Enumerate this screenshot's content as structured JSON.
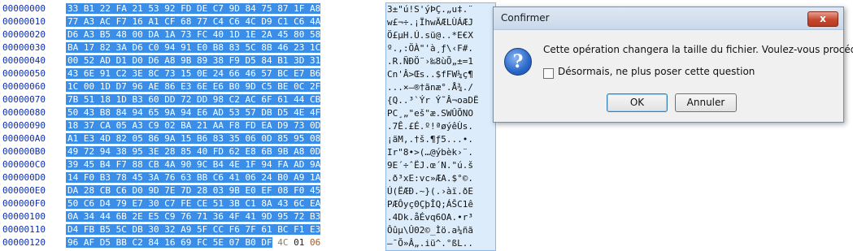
{
  "editor": {
    "offsets": [
      "00000000",
      "00000010",
      "00000020",
      "00000030",
      "00000040",
      "00000050",
      "00000060",
      "00000070",
      "00000080",
      "00000090",
      "000000A0",
      "000000B0",
      "000000C0",
      "000000D0",
      "000000E0",
      "000000F0",
      "00000100",
      "00000110",
      "00000120"
    ],
    "hex_rows": [
      "33 B1 22 FA 21 53 92 FD DE C7 9D 84 75 87 1F A8",
      "77 A3 AC F7 16 A1 CF 68 77 C4 C6 4C D9 C1 C6 4A",
      "D6 A3 B5 48 00 DA 1A 73 FC 40 1D 1E 2A 45 80 58",
      "BA 17 82 3A D6 C0 94 91 E0 B8 83 5C 8B 46 23 1C",
      "00 52 AD D1 D0 D6 A8 9B 89 38 F9 D5 84 B1 3D 31",
      "43 6E 91 C2 3E 8C 73 15 0E 24 66 46 57 BC E7 B6",
      "1C 00 1D D7 96 AE 86 E3 6E E6 B0 9D C5 BE 0C 2F",
      "7B 51 18 1D B3 60 DD 72 DD 98 C2 AC 6F 61 44 CB",
      "50 43 B8 84 94 65 9A 94 E6 AD 53 57 DB D5 4E 4F",
      "18 37 CA 05 A3 C9 02 BA 21 AA F8 FD EA D9 73 0D",
      "A1 E3 4D 82 05 86 9A 15 B6 83 35 06 0D 85 95 08",
      "49 72 94 38 95 3E 28 85 40 FD 62 E8 6B 9B A8 0D",
      "39 45 B4 F7 88 CB 4A 90 9C B4 4E 1F 94 FA AD 9A",
      "14 F0 B3 78 45 3A 76 63 BB C6 41 06 24 B0 A9 1A",
      "DA 28 CB C6 D0 9D 7E 7D 28 03 9B E0 EF 08 F0 45",
      "50 C6 D4 79 E7 30 C7 FE CE 51 3B C1 8A 43 6C EA",
      "0A 34 44 6B 2E E5 C9 76 71 36 4F 41 9D 95 72 B3",
      "D4 FB B5 5C DB 30 32 A9 5F CC F6 7F 61 BC F1 E3",
      "96 AF D5 BB C2 84 16 69 FC 5E 07 B0 DF"
    ],
    "last_row_tail": [
      "4C",
      "01",
      "06"
    ],
    "ascii_rows": [
      "3±\"ú!S'ýÞÇ.„u‡.¨",
      "w£¬÷.¡ÏhwÄÆLÙÁÆJ",
      "Ö£µH.Ú.sü@..*E€X",
      "º.‚:ÖÀ\"'à¸ƒ\\‹F#.",
      ".R.ÑÐÖ¨›‰8ùÕ„±=1",
      "Cn'Â>Œs..$fFW¼ç¶",
      "...×–®†ãnæ°.Å¾./",
      "{Q..³`Ýr Ý˜Â¬oaDË",
      "PC¸„\"eš\"æ.SWÛÕNO",
      ".7Ê.£É.º!ªøýêÙs.",
      "¡ãM‚.†š.¶ƒ5...•.",
      "Ir\"8•>(…@ýbèk›¨.",
      "9E´÷ˆËJ.œ´N.\"ú.š",
      ".ð³xE:vc»ÆA.$°©.",
      "Ú(ËÆÐ.~}(.›àï.ðE",
      "PÆÔyç0ÇþÎQ;ÁŠC1ê",
      ".4Dk.åÉvq6OA.•r³",
      "Ôûµ\\Û02©_Ìö.a¼ñã",
      "–¯Õ»Â„.iü^.°ßL.."
    ]
  },
  "dialog": {
    "title": "Confirmer",
    "close_glyph": "x",
    "icon_glyph": "?",
    "message": "Cette opération changera la taille du fichier. Voulez-vous procéder?",
    "checkbox_label": "Désormais, ne plus poser cette question",
    "checkbox_checked": false,
    "ok_label": "OK",
    "cancel_label": "Annuler"
  },
  "colors": {
    "selection": "#3b8ee8",
    "offset_text": "#0c2fb0",
    "ascii_selection": "#dcecfa"
  }
}
